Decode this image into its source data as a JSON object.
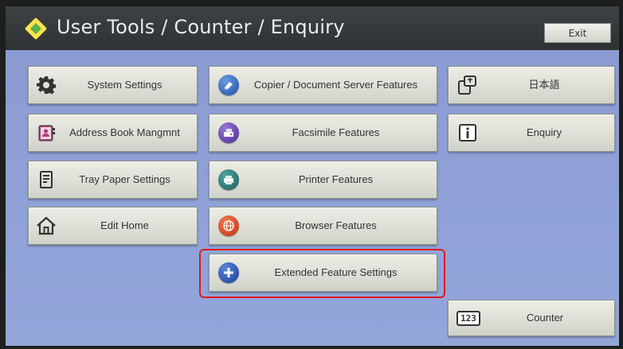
{
  "header": {
    "title": "User Tools / Counter / Enquiry",
    "exit_label": "Exit"
  },
  "left": {
    "system_settings": "System Settings",
    "address_book": "Address Book Mangmnt",
    "tray_paper": "Tray Paper Settings",
    "edit_home": "Edit Home"
  },
  "middle": {
    "copier": "Copier / Document Server Features",
    "facsimile": "Facsimile Features",
    "printer": "Printer Features",
    "browser": "Browser Features",
    "extended": "Extended Feature Settings"
  },
  "right": {
    "language": "日本語",
    "enquiry": "Enquiry",
    "counter": "Counter",
    "counter_icon_text": "123"
  },
  "colors": {
    "highlight": "#e01818",
    "button_face": "#e2e4dc",
    "screen_bg": "#8d9fd5"
  },
  "icons": [
    "gear-icon",
    "address-book-icon",
    "tray-icon",
    "home-icon",
    "copier-icon",
    "fax-icon",
    "printer-icon",
    "globe-icon",
    "puzzle-icon",
    "language-switch-icon",
    "info-icon",
    "counter-icon"
  ]
}
